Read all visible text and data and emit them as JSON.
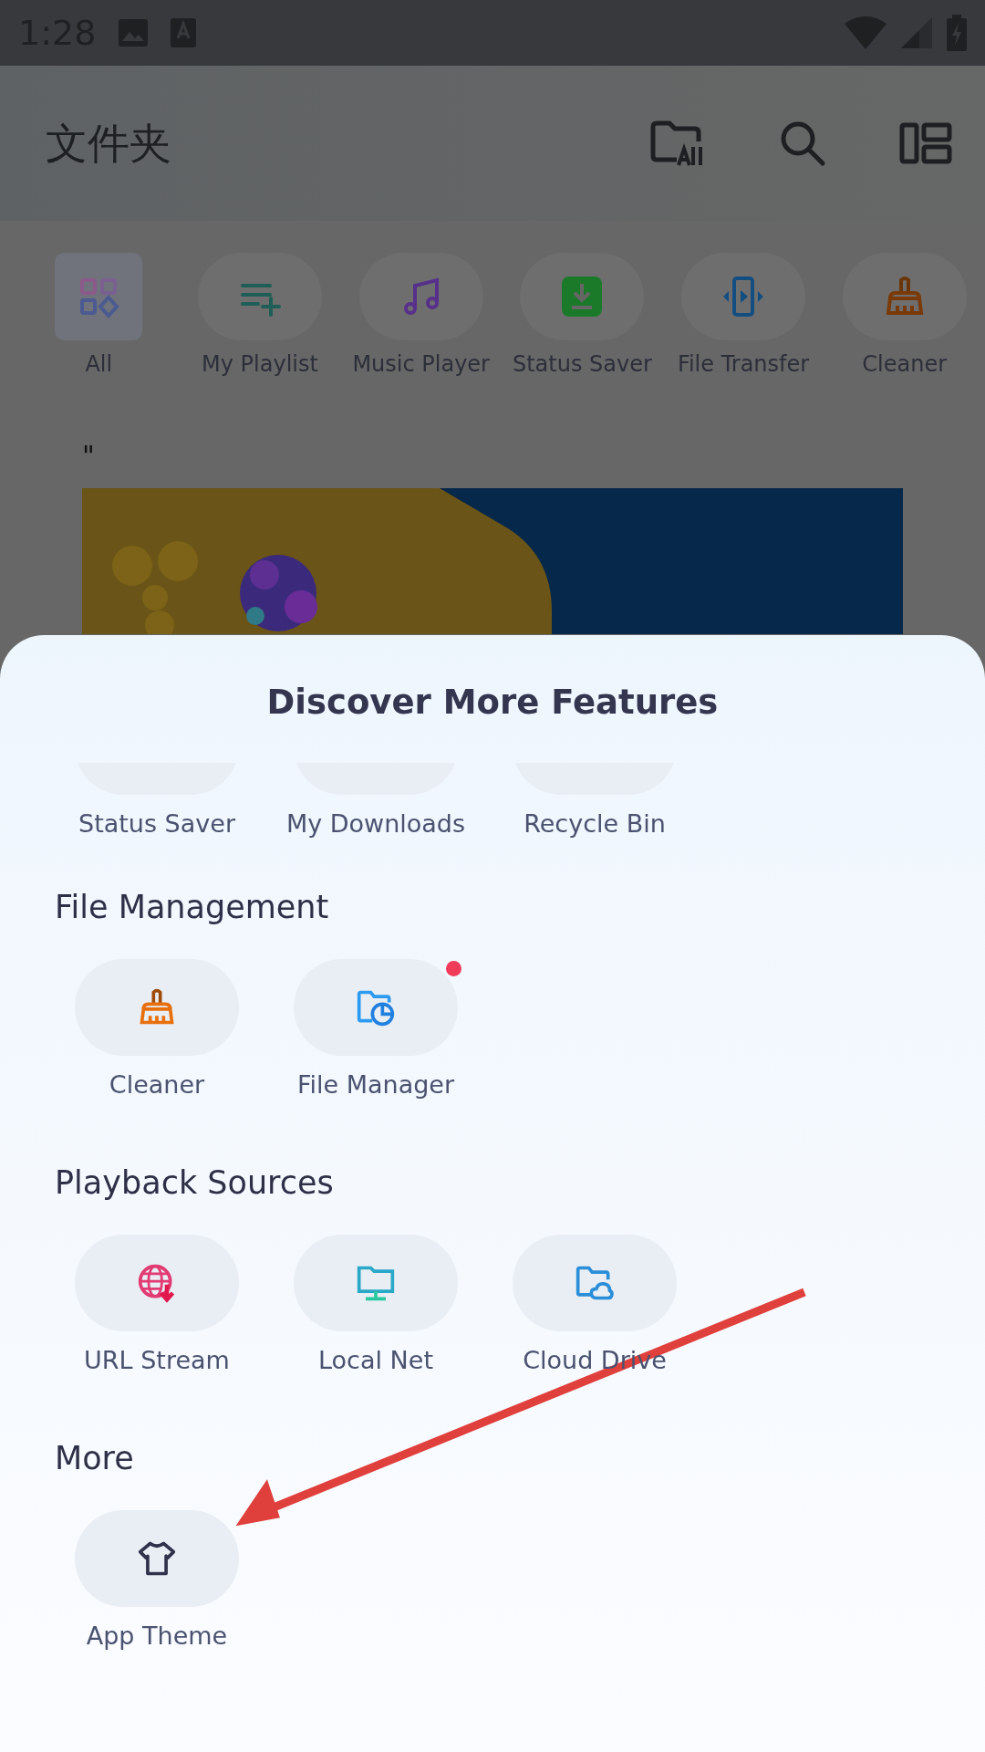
{
  "status_bar": {
    "time": "1:28"
  },
  "app_bar": {
    "title": "文件夹"
  },
  "shortcuts": [
    {
      "label": "All",
      "kind": "all",
      "selected": true
    },
    {
      "label": "My Playlist",
      "kind": "playlist",
      "selected": false
    },
    {
      "label": "Music Player",
      "kind": "music",
      "selected": false
    },
    {
      "label": "Status Saver",
      "kind": "saver",
      "selected": false
    },
    {
      "label": "File Transfer",
      "kind": "transfer",
      "selected": false
    },
    {
      "label": "Cleaner",
      "kind": "cleaner",
      "selected": false
    }
  ],
  "banner_caption": "\"",
  "sheet": {
    "title": "Discover More Features",
    "sections": [
      {
        "items": [
          {
            "label": "Status Saver",
            "kind": "hidden"
          },
          {
            "label": "My Downloads",
            "kind": "hidden"
          },
          {
            "label": "Recycle Bin",
            "kind": "hidden"
          }
        ]
      },
      {
        "heading": "File Management",
        "items": [
          {
            "label": "Cleaner",
            "kind": "cleaner",
            "badge": false
          },
          {
            "label": "File Manager",
            "kind": "filemanager",
            "badge": true
          }
        ]
      },
      {
        "heading": "Playback Sources",
        "items": [
          {
            "label": "URL Stream",
            "kind": "url",
            "badge": false
          },
          {
            "label": "Local Net",
            "kind": "localnet",
            "badge": false
          },
          {
            "label": "Cloud Drive",
            "kind": "cloud",
            "badge": false
          }
        ]
      },
      {
        "heading": "More",
        "items": [
          {
            "label": "App Theme",
            "kind": "theme",
            "badge": false
          }
        ]
      }
    ]
  }
}
